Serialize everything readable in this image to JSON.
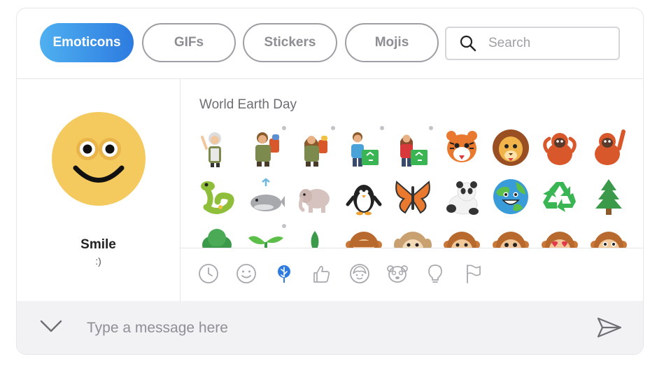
{
  "tabs": [
    {
      "label": "Emoticons",
      "active": true
    },
    {
      "label": "GIFs",
      "active": false
    },
    {
      "label": "Stickers",
      "active": false
    },
    {
      "label": "Mojis",
      "active": false
    }
  ],
  "search": {
    "placeholder": "Search",
    "icon": "search-icon"
  },
  "preview": {
    "name": "Smile",
    "shortcut": ":)"
  },
  "section": {
    "title": "World Earth Day"
  },
  "emojis": [
    [
      "woman-scientist",
      "man-volunteer",
      "woman-volunteer",
      "man-recycling",
      "woman-recycling",
      "tiger",
      "lion",
      "orangutan",
      "orangutan-waving"
    ],
    [
      "lizard",
      "whale",
      "elephant",
      "penguin",
      "butterfly",
      "panda",
      "earth-globe",
      "recycle",
      "evergreen-tree"
    ],
    [
      "bush",
      "seedling",
      "plant",
      "monkey-see-no-evil",
      "monkey-hear-no-evil",
      "monkey-speak-no-evil",
      "monkey",
      "monkey-heart-eyes",
      "monkey-thinking"
    ]
  ],
  "categories": [
    "recent-clock-icon",
    "smiley-icon",
    "earth-day-leaf-icon",
    "thumbs-up-icon",
    "face-icon",
    "animal-icon",
    "lightbulb-icon",
    "flag-icon"
  ],
  "active_category": "earth-day-leaf-icon",
  "composer": {
    "placeholder": "Type a message here"
  },
  "colors": {
    "accent_start": "#4fb0f0",
    "accent_end": "#2d7be0",
    "active_category": "#2d7be0",
    "border": "#e6e6ea",
    "composer_bg": "#f2f2f4"
  }
}
